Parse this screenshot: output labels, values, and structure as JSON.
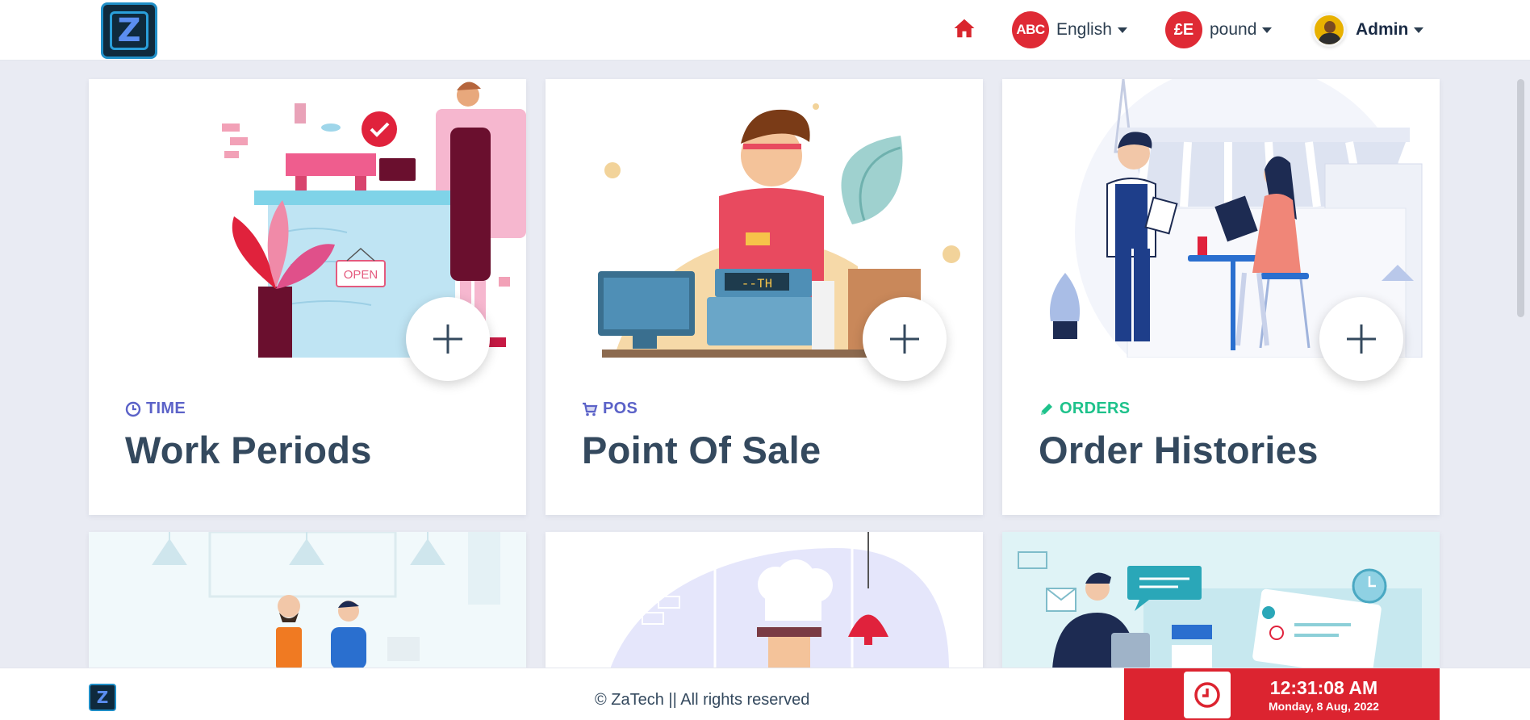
{
  "header": {
    "language_badge": "ABC",
    "language_label": "English",
    "currency_badge": "£E",
    "currency_label": "pound",
    "user_label": "Admin"
  },
  "cards": [
    {
      "category": "TIME",
      "category_color": "#5b62c8",
      "title": "Work Periods",
      "icon": "clock-icon"
    },
    {
      "category": "POS",
      "category_color": "#5b62c8",
      "title": "Point Of Sale",
      "icon": "cart-icon"
    },
    {
      "category": "ORDERS",
      "category_color": "#1ec28b",
      "title": "Order Histories",
      "icon": "pencil-icon"
    }
  ],
  "footer": {
    "copyright": "© ZaTech || All rights reserved",
    "time": "12:31:08 AM",
    "date": "Monday, 8 Aug, 2022"
  },
  "colors": {
    "accent_red": "#dc2430",
    "text_dark": "#34495e",
    "background": "#e9ebf3"
  }
}
